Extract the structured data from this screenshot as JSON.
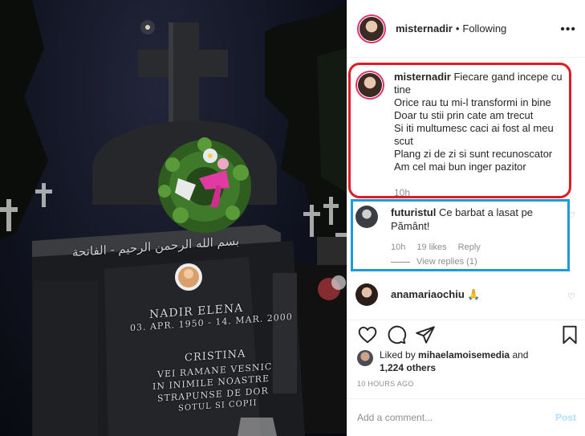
{
  "post": {
    "username": "misternadir",
    "separator": "•",
    "follow_status": "Following",
    "more_label": "•••"
  },
  "caption": {
    "username": "misternadir",
    "text": "Fiecare gand incepe cu tine\nOrice rau tu mi-l transformi in bine\nDoar tu stii prin cate am trecut\nSi iti multumesc caci ai fost al meu scut\nPlang zi de zi si sunt recunoscator\nAm cel mai bun inger pazitor",
    "time": "10h"
  },
  "comments": [
    {
      "username": "futuristul",
      "text": "Ce barbat a lasat pe Pământ!",
      "time": "10h",
      "likes": "19 likes",
      "reply_label": "Reply",
      "view_replies": "View replies (1)"
    },
    {
      "username": "anamariaochiu",
      "text": "🙏",
      "time": "",
      "likes": ""
    }
  ],
  "likes": {
    "liked_by_prefix": "Liked by",
    "liked_by_user": "mihaelamoisemedia",
    "and": "and",
    "others": "1,224 others"
  },
  "timestamp": "10 HOURS AGO",
  "add_comment": {
    "placeholder": "Add a comment...",
    "post_label": "Post"
  },
  "photo": {
    "arabic_line": "بسم الله الرحمن الرحيم - الفاتحة",
    "name_line": "NADIR ELENA",
    "dates_line": "03. APR. 1950 - 14. MAR. 2000",
    "second_name": "CRISTINA",
    "epitaph_1": "VEI RAMANE VESNIC",
    "epitaph_2": "IN INIMILE NOASTRE",
    "epitaph_3": "STRAPUNSE DE DOR",
    "epitaph_4": "SOTUL SI COPII"
  },
  "colors": {
    "highlight_red": "#e01b24",
    "highlight_blue": "#1c9bd8",
    "post_button": "#b2dffc"
  }
}
